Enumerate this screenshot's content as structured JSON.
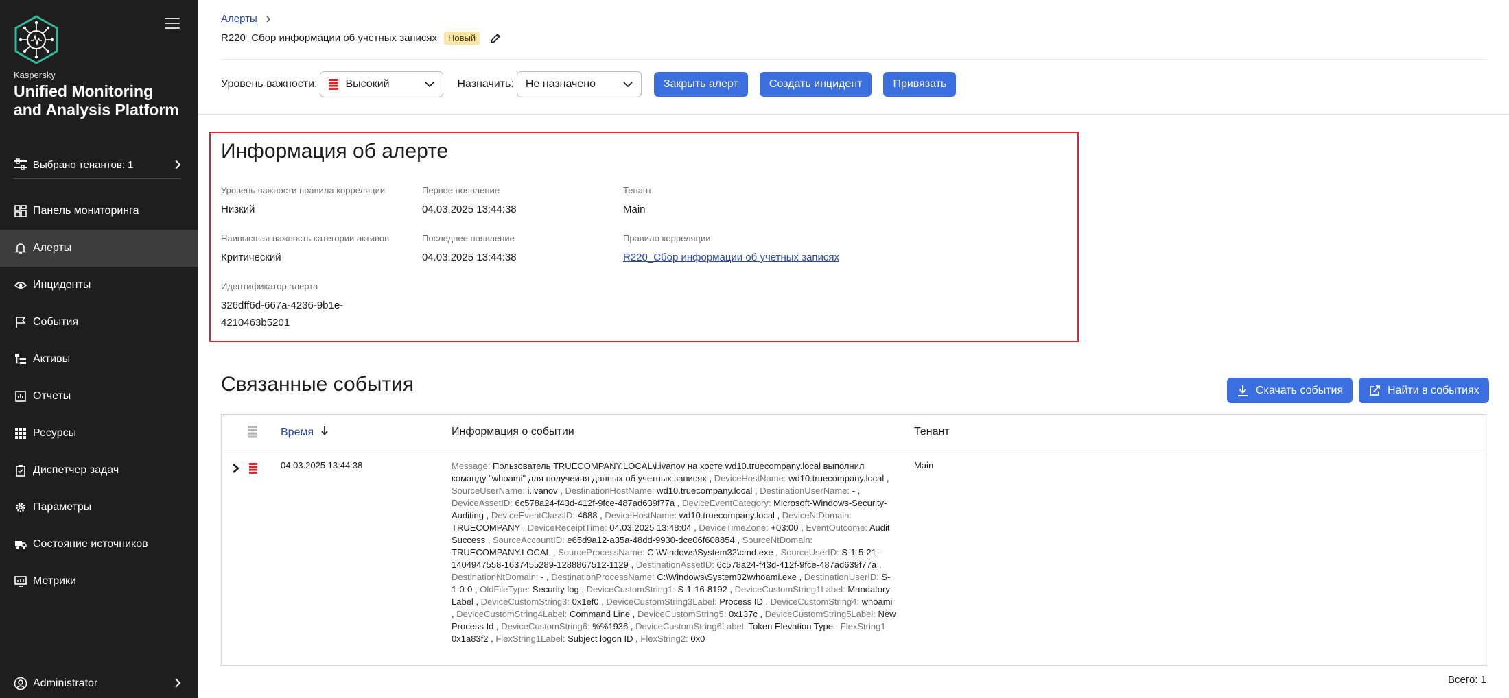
{
  "sidebar": {
    "brand_small": "Kaspersky",
    "brand_title": "Unified Monitoring and Analysis Platform",
    "tenant_selector": "Выбрано тенантов: 1",
    "items": [
      {
        "label": "Панель мониторинга",
        "icon": "dashboard-icon"
      },
      {
        "label": "Алерты",
        "icon": "bell-icon",
        "active": true
      },
      {
        "label": "Инциденты",
        "icon": "eye-icon"
      },
      {
        "label": "События",
        "icon": "flag-icon"
      },
      {
        "label": "Активы",
        "icon": "tree-icon"
      },
      {
        "label": "Отчеты",
        "icon": "report-icon"
      },
      {
        "label": "Ресурсы",
        "icon": "grid-icon"
      },
      {
        "label": "Диспетчер задач",
        "icon": "clipboard-icon"
      },
      {
        "label": "Параметры",
        "icon": "gear-icon"
      },
      {
        "label": "Состояние источников",
        "icon": "truck-icon"
      },
      {
        "label": "Метрики",
        "icon": "monitor-icon"
      }
    ],
    "user": "Administrator"
  },
  "header": {
    "breadcrumb": "Алерты",
    "title": "R220_Сбор информации об учетных записях",
    "status_badge": "Новый",
    "severity_label": "Уровень важности:",
    "severity_value": "Высокий",
    "assign_label": "Назначить:",
    "assign_value": "Не назначено",
    "btn_close": "Закрыть алерт",
    "btn_create_incident": "Создать инцидент",
    "btn_link": "Привязать"
  },
  "info": {
    "title": "Информация об алерте",
    "rule_severity_label": "Уровень важности правила корреляции",
    "rule_severity_value": "Низкий",
    "first_seen_label": "Первое появление",
    "first_seen_value": "04.03.2025 13:44:38",
    "tenant_label": "Тенант",
    "tenant_value": "Main",
    "asset_category_label": "Наивысшая важность категории активов",
    "asset_category_value": "Критический",
    "last_seen_label": "Последнее появление",
    "last_seen_value": "04.03.2025 13:44:38",
    "correlation_rule_label": "Правило корреляции",
    "correlation_rule_value": "R220_Сбор информации об учетных записях",
    "alert_id_label": "Идентификатор алерта",
    "alert_id_line1": "326dff6d-667a-4236-9b1e-",
    "alert_id_line2": "4210463b5201"
  },
  "related": {
    "title": "Связанные события",
    "btn_download": "Скачать события",
    "btn_find": "Найти в событиях",
    "columns": {
      "time": "Время",
      "info": "Информация о событии",
      "tenant": "Тенант"
    },
    "row": {
      "time": "04.03.2025 13:44:38",
      "tenant": "Main",
      "fields": [
        {
          "k": "Message:",
          "v": "Пользователь TRUECOMPANY.LOCAL\\i.ivanov на хосте wd10.truecompany.local выполнил команду \"whoami\" для получеиня данных об учетных записях"
        },
        {
          "k": "DeviceHostName:",
          "v": "wd10.truecompany.local"
        },
        {
          "k": "SourceUserName:",
          "v": "i.ivanov"
        },
        {
          "k": "DestinationHostName:",
          "v": "wd10.truecompany.local"
        },
        {
          "k": "DestinationUserName:",
          "v": "-"
        },
        {
          "k": "DeviceAssetID:",
          "v": "6c578a24-f43d-412f-9fce-487ad639f77a"
        },
        {
          "k": "DeviceEventCategory:",
          "v": "Microsoft-Windows-Security-Auditing"
        },
        {
          "k": "DeviceEventClassID:",
          "v": "4688"
        },
        {
          "k": "DeviceHostName:",
          "v": "wd10.truecompany.local"
        },
        {
          "k": "DeviceNtDomain:",
          "v": "TRUECOMPANY"
        },
        {
          "k": "DeviceReceiptTime:",
          "v": "04.03.2025 13:48:04"
        },
        {
          "k": "DeviceTimeZone:",
          "v": "+03:00"
        },
        {
          "k": "EventOutcome:",
          "v": "Audit Success"
        },
        {
          "k": "SourceAccountID:",
          "v": "e65d9a12-a35a-48dd-9930-dce06f608854"
        },
        {
          "k": "SourceNtDomain:",
          "v": "TRUECOMPANY.LOCAL"
        },
        {
          "k": "SourceProcessName:",
          "v": "C:\\Windows\\System32\\cmd.exe"
        },
        {
          "k": "SourceUserID:",
          "v": "S-1-5-21-1404947558-1637455289-1288867512-1129"
        },
        {
          "k": "DestinationAssetID:",
          "v": "6c578a24-f43d-412f-9fce-487ad639f77a"
        },
        {
          "k": "DestinationNtDomain:",
          "v": "-"
        },
        {
          "k": "DestinationProcessName:",
          "v": "C:\\Windows\\System32\\whoami.exe"
        },
        {
          "k": "DestinationUserID:",
          "v": "S-1-0-0"
        },
        {
          "k": "OldFileType:",
          "v": "Security log"
        },
        {
          "k": "DeviceCustomString1:",
          "v": "S-1-16-8192"
        },
        {
          "k": "DeviceCustomString1Label:",
          "v": "Mandatory Label"
        },
        {
          "k": "DeviceCustomString3:",
          "v": "0x1ef0"
        },
        {
          "k": "DeviceCustomString3Label:",
          "v": "Process ID"
        },
        {
          "k": "DeviceCustomString4:",
          "v": "whoami"
        },
        {
          "k": "DeviceCustomString4Label:",
          "v": "Command Line"
        },
        {
          "k": "DeviceCustomString5:",
          "v": "0x137c"
        },
        {
          "k": "DeviceCustomString5Label:",
          "v": "New Process Id"
        },
        {
          "k": "DeviceCustomString6:",
          "v": "%%1936"
        },
        {
          "k": "DeviceCustomString6Label:",
          "v": "Token Elevation Type"
        },
        {
          "k": "FlexString1:",
          "v": "0x1a83f2"
        },
        {
          "k": "FlexString1Label:",
          "v": "Subject logon ID"
        },
        {
          "k": "FlexString2:",
          "v": "0x0"
        }
      ]
    },
    "total": "Всего: 1"
  },
  "colors": {
    "accent": "#3b6fe0",
    "sidebar": "#1e1e1e",
    "severity_red": "#d9262c",
    "link": "#2a48a9"
  }
}
